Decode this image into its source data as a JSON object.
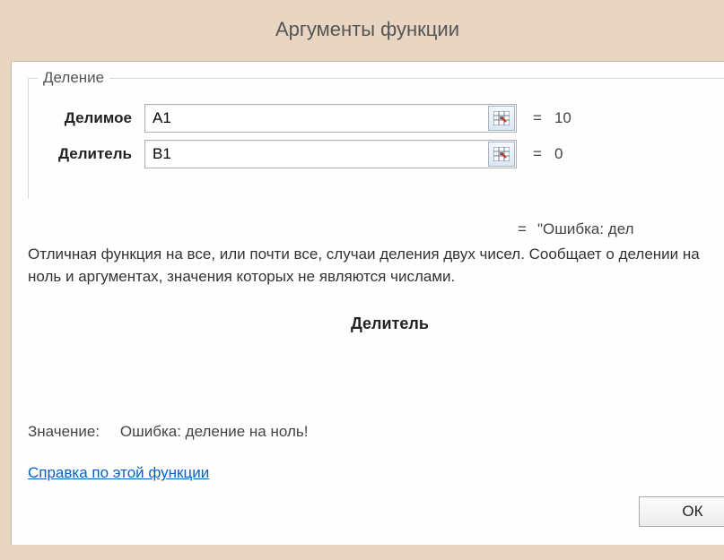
{
  "title": "Аргументы функции",
  "fieldset_legend": "Деление",
  "args": {
    "dividend": {
      "label": "Делимое",
      "value": "A1",
      "result": "10"
    },
    "divisor": {
      "label": "Делитель",
      "value": "B1",
      "result": "0"
    }
  },
  "equals": "=",
  "formula_result": "\"Ошибка: дел",
  "description": "Отличная функция на все, или почти все, случаи деления двух чисел. Сообщает о делении на ноль и аргументах, значения которых не являются числами.",
  "current_arg": "Делитель",
  "value_label": "Значение:",
  "value_text": "Ошибка: деление на ноль!",
  "help_link": "Справка по этой функции",
  "ok_label": "ОК"
}
